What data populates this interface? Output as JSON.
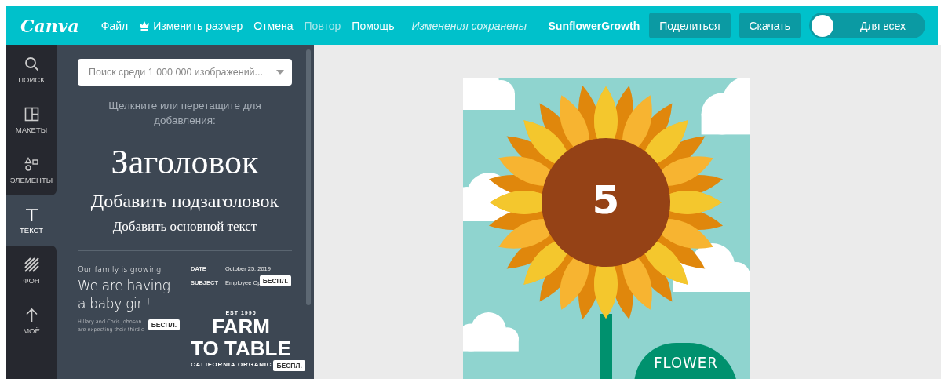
{
  "topbar": {
    "logo": "Canva",
    "menu": [
      {
        "label": "Файл",
        "kind": "plain",
        "disabled": false
      },
      {
        "label": "Изменить размер",
        "kind": "crown",
        "disabled": false
      },
      {
        "label": "Отмена",
        "kind": "plain",
        "disabled": false
      },
      {
        "label": "Повтор",
        "kind": "plain",
        "disabled": true
      },
      {
        "label": "Помощь",
        "kind": "plain",
        "disabled": false
      }
    ],
    "save_status": "Изменения сохранены",
    "design_name": "SunflowerGrowth",
    "buttons": [
      "Поделиться",
      "Скачать"
    ],
    "visibility": {
      "label": "Для всех",
      "on": false
    }
  },
  "sidebar": {
    "items": [
      {
        "label": "ПОИСК",
        "kind": "search",
        "selected": false
      },
      {
        "label": "МАКЕТЫ",
        "kind": "layouts",
        "selected": false
      },
      {
        "label": "ЭЛЕМЕНТЫ",
        "kind": "elements",
        "selected": false
      },
      {
        "label": "ТЕКСТ",
        "kind": "text",
        "selected": true
      },
      {
        "label": "ФОН",
        "kind": "background",
        "selected": false
      },
      {
        "label": "МОЁ",
        "kind": "uploads",
        "selected": false
      }
    ]
  },
  "panel": {
    "search": {
      "placeholder": "Поиск среди 1 000 000 изображений..."
    },
    "hint": "Щелкните или перетащите для добавления:",
    "text_styles": [
      {
        "kind": "heading",
        "label": "Заголовок"
      },
      {
        "kind": "subheading",
        "label": "Добавить подзаголовок"
      },
      {
        "kind": "body",
        "label": "Добавить основной текст"
      }
    ],
    "templates": [
      {
        "kind": "baby",
        "lines": [
          "Our family is growing.",
          "We are having a baby girl!",
          "Hillary and Chris Johnson are expecting their third c"
        ],
        "badge": "БЕСПЛ."
      },
      {
        "kind": "memo",
        "lines": [
          "DATE",
          "October 25, 2019",
          "SUBJECT",
          "Employee Op"
        ],
        "badge": "БЕСПЛ."
      },
      {
        "kind": "farm",
        "lines": [
          "EST 1995",
          "FARM",
          "TO TABLE",
          "CALIFORNIA ORGANIC"
        ],
        "badge": "БЕСПЛ."
      }
    ]
  },
  "design": {
    "number": "5",
    "leaf_text": "FLOWER"
  }
}
